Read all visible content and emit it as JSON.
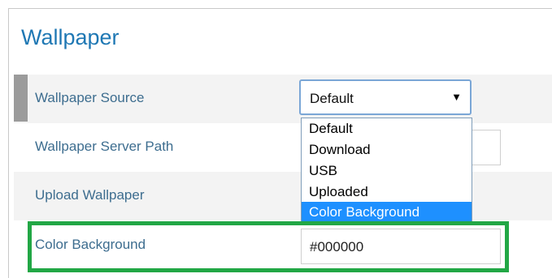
{
  "section": {
    "title": "Wallpaper"
  },
  "fields": {
    "wallpaper_source": {
      "label": "Wallpaper Source",
      "value": "Default",
      "arrow_icon": "caret-down"
    },
    "server_path": {
      "label": "Wallpaper Server Path",
      "value": ""
    },
    "upload": {
      "label": "Upload Wallpaper"
    },
    "color_background": {
      "label": "Color Background",
      "value": "#000000"
    }
  },
  "dropdown": {
    "options": [
      "Default",
      "Download",
      "USB",
      "Uploaded",
      "Color Background"
    ],
    "selected": "Color Background"
  },
  "colors": {
    "title": "#1f78b4",
    "label": "#3d6d8f",
    "selected_option": "#1e90ff",
    "highlight_border": "#22a745"
  }
}
